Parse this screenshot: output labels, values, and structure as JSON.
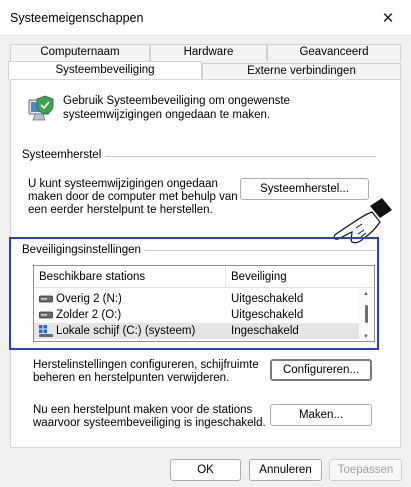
{
  "window": {
    "title": "Systeemeigenschappen",
    "close_glyph": "✕"
  },
  "tabs": {
    "row1": [
      "Computernaam",
      "Hardware",
      "Geavanceerd"
    ],
    "row2": [
      "Systeembeveiliging",
      "Externe verbindingen"
    ],
    "active": "Systeembeveiliging"
  },
  "intro": {
    "icon": "system-protection-icon",
    "text": "Gebruik Systeembeveiliging om ongewenste systeemwijzigingen ongedaan te maken."
  },
  "restore": {
    "group_label": "Systeemherstel",
    "text": "U kunt systeemwijzigingen ongedaan maken door de computer met behulp van een eerder herstelpunt te herstellen.",
    "button": "Systeemherstel..."
  },
  "protection": {
    "group_label": "Beveiligingsinstellingen",
    "columns": [
      "Beschikbare stations",
      "Beveiliging"
    ],
    "drives": [
      {
        "name": "Overig 2 (N:)",
        "status": "Uitgeschakeld",
        "icon": "drive-icon",
        "selected": false
      },
      {
        "name": "Zolder 2 (O:)",
        "status": "Uitgeschakeld",
        "icon": "drive-icon",
        "selected": false
      },
      {
        "name": "Lokale schijf (C:) (systeem)",
        "status": "Ingeschakeld",
        "icon": "windows-drive-icon",
        "selected": true
      }
    ],
    "highlight_color": "#2b3fcf"
  },
  "configure": {
    "text": "Herstelinstellingen configureren, schijfruimte beheren en herstelpunten verwijderen.",
    "button": "Configureren..."
  },
  "create": {
    "text": "Nu een herstelpunt maken voor de stations waarvoor systeembeveiliging is ingeschakeld.",
    "button": "Maken..."
  },
  "footer": {
    "ok": "OK",
    "cancel": "Annuleren",
    "apply": "Toepassen"
  },
  "pointer": {
    "icon": "pointing-hand-icon"
  }
}
